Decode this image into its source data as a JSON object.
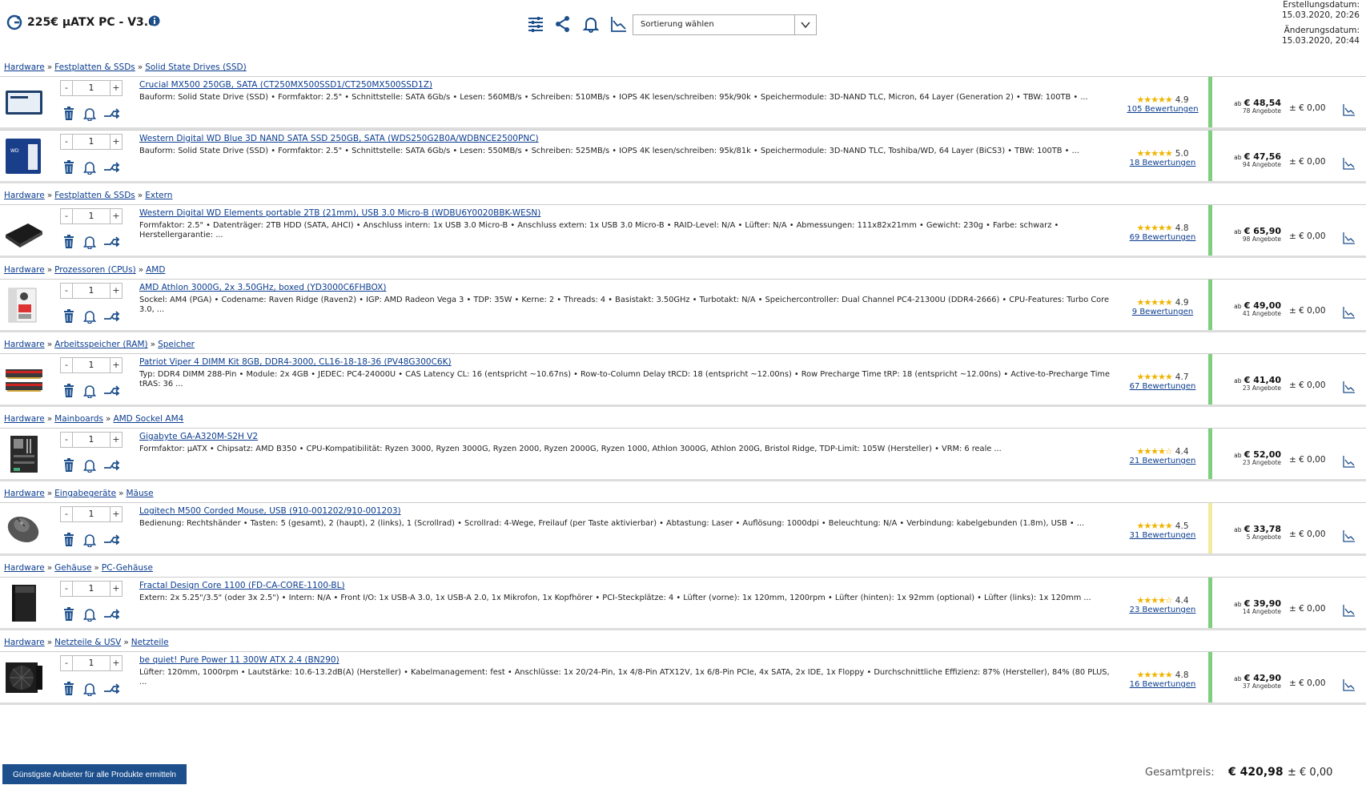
{
  "header": {
    "title": "225€ µATX PC - V3.0",
    "sort_placeholder": "Sortierung wählen",
    "created_label": "Erstellungsdatum:",
    "created_value": "15.03.2020, 20:26",
    "changed_label": "Änderungsdatum:",
    "changed_value": "15.03.2020, 20:44"
  },
  "groups": [
    {
      "crumbs": [
        "Hardware",
        "Festplatten & SSDs",
        "Solid State Drives (SSD)"
      ],
      "products": [
        {
          "name": "Crucial MX500 250GB, SATA (CT250MX500SSD1/CT250MX500SSD1Z)",
          "qty": "1",
          "desc": "Bauform: Solid State Drive (SSD) • Formfaktor: 2.5\" • Schnittstelle: SATA 6Gb/s • Lesen: 560MB/s • Schreiben: 510MB/s • IOPS 4K lesen/schreiben: 95k/90k • Speichermodule: 3D-NAND TLC, Micron, 64 Layer (Generation 2) • TBW: 100TB • ...",
          "rating": "4.9",
          "rating_fill": 0.98,
          "reviews": "105 Bewertungen",
          "price": "€ 48,54",
          "offers": "78 Angebote",
          "delta": "± € 0,00",
          "image": "ssd-crucial"
        },
        {
          "name": "Western Digital WD Blue 3D NAND SATA SSD 250GB, SATA (WDS250G2B0A/WDBNCE2500PNC)",
          "qty": "1",
          "desc": "Bauform: Solid State Drive (SSD) • Formfaktor: 2.5\" • Schnittstelle: SATA 6Gb/s • Lesen: 550MB/s • Schreiben: 525MB/s • IOPS 4K lesen/schreiben: 95k/81k • Speichermodule: 3D-NAND TLC, Toshiba/WD, 64 Layer (BiCS3) • TBW: 100TB • ...",
          "rating": "5.0",
          "rating_fill": 1.0,
          "reviews": "18 Bewertungen",
          "price": "€ 47,56",
          "offers": "94 Angebote",
          "delta": "± € 0,00",
          "image": "ssd-wd"
        }
      ]
    },
    {
      "crumbs": [
        "Hardware",
        "Festplatten & SSDs",
        "Extern"
      ],
      "products": [
        {
          "name": "Western Digital WD Elements portable 2TB (21mm), USB 3.0 Micro-B (WDBU6Y0020BBK-WESN)",
          "qty": "1",
          "desc": "Formfaktor: 2.5\" • Datenträger: 2TB HDD (SATA, AHCI) • Anschluss intern: 1x USB 3.0 Micro-B • Anschluss extern: 1x USB 3.0 Micro-B • RAID-Level: N/A • Lüfter: N/A • Abmessungen: 111x82x21mm • Gewicht: 230g • Farbe: schwarz • Herstellergarantie: ...",
          "rating": "4.8",
          "rating_fill": 0.96,
          "reviews": "69 Bewertungen",
          "price": "€ 65,90",
          "offers": "98 Angebote",
          "delta": "± € 0,00",
          "image": "hdd-external"
        }
      ]
    },
    {
      "crumbs": [
        "Hardware",
        "Prozessoren (CPUs)",
        "AMD"
      ],
      "products": [
        {
          "name": "AMD Athlon 3000G, 2x 3.50GHz, boxed (YD3000C6FHBOX)",
          "qty": "1",
          "desc": "Sockel: AM4 (PGA) • Codename: Raven Ridge (Raven2) • IGP: AMD Radeon Vega 3 • TDP: 35W • Kerne: 2 • Threads: 4 • Basistakt: 3.50GHz • Turbotakt: N/A • Speichercontroller: Dual Channel PC4-21300U (DDR4-2666) • CPU-Features: Turbo Core 3.0, ...",
          "rating": "4.9",
          "rating_fill": 0.98,
          "reviews": "9 Bewertungen",
          "price": "€ 49,00",
          "offers": "41 Angebote",
          "delta": "± € 0,00",
          "image": "cpu-box"
        }
      ]
    },
    {
      "crumbs": [
        "Hardware",
        "Arbeitsspeicher (RAM)",
        "Speicher"
      ],
      "products": [
        {
          "name": "Patriot Viper 4 DIMM Kit 8GB, DDR4-3000, CL16-18-18-36 (PV48G300C6K)",
          "qty": "1",
          "desc": "Typ: DDR4 DIMM 288-Pin • Module: 2x 4GB • JEDEC: PC4-24000U • CAS Latency CL: 16 (entspricht ~10.67ns) • Row-to-Column Delay tRCD: 18 (entspricht ~12.00ns) • Row Precharge Time tRP: 18 (entspricht ~12.00ns) • Active-to-Precharge Time tRAS: 36 ...",
          "rating": "4.7",
          "rating_fill": 0.94,
          "reviews": "67 Bewertungen",
          "price": "€ 41,40",
          "offers": "23 Angebote",
          "delta": "± € 0,00",
          "image": "ram-kit"
        }
      ]
    },
    {
      "crumbs": [
        "Hardware",
        "Mainboards",
        "AMD Sockel AM4"
      ],
      "products": [
        {
          "name": "Gigabyte GA-A320M-S2H V2",
          "qty": "1",
          "desc": "Formfaktor: µATX • Chipsatz: AMD B350 • CPU-Kompatibilität: Ryzen 3000, Ryzen 3000G, Ryzen 2000, Ryzen 2000G, Ryzen 1000, Athlon 3000G, Athlon 200G, Bristol Ridge, TDP-Limit: 105W (Hersteller) • VRM: 6 reale ...",
          "rating": "4.4",
          "rating_fill": 0.88,
          "reviews": "21 Bewertungen",
          "price": "€ 52,00",
          "offers": "23 Angebote",
          "delta": "± € 0,00",
          "image": "mainboard"
        }
      ]
    },
    {
      "crumbs": [
        "Hardware",
        "Eingabegeräte",
        "Mäuse"
      ],
      "products": [
        {
          "name": "Logitech M500 Corded Mouse, USB (910-001202/910-001203)",
          "qty": "1",
          "desc": "Bedienung: Rechtshänder • Tasten: 5 (gesamt), 2 (haupt), 2 (links), 1 (Scrollrad) • Scrollrad: 4-Wege, Freilauf (per Taste aktivierbar) • Abtastung: Laser • Auflösung: 1000dpi • Beleuchtung: N/A • Verbindung: kabelgebunden (1.8m), USB • ...",
          "rating": "4.5",
          "rating_fill": 0.9,
          "reviews": "31 Bewertungen",
          "price": "€ 33,78",
          "offers": "5 Angebote",
          "delta": "± € 0,00",
          "image": "mouse"
        }
      ]
    },
    {
      "crumbs": [
        "Hardware",
        "Gehäuse",
        "PC-Gehäuse"
      ],
      "products": [
        {
          "name": "Fractal Design Core 1100 (FD-CA-CORE-1100-BL)",
          "qty": "1",
          "desc": "Extern: 2x 5.25\"/3.5\" (oder 3x 2.5\") • Intern: N/A • Front I/O: 1x USB-A 3.0, 1x USB-A 2.0, 1x Mikrofon, 1x Kopfhörer • PCI-Steckplätze: 4 • Lüfter (vorne): 1x 120mm, 1200rpm • Lüfter (hinten): 1x 92mm (optional) • Lüfter (links): 1x 120mm ...",
          "rating": "4.4",
          "rating_fill": 0.88,
          "reviews": "23 Bewertungen",
          "price": "€ 39,90",
          "offers": "14 Angebote",
          "delta": "± € 0,00",
          "image": "case"
        }
      ]
    },
    {
      "crumbs": [
        "Hardware",
        "Netzteile & USV",
        "Netzteile"
      ],
      "products": [
        {
          "name": "be quiet! Pure Power 11 300W ATX 2.4 (BN290)",
          "qty": "1",
          "desc": "Lüfter: 120mm, 1000rpm • Lautstärke: 10.6-13.2dB(A) (Hersteller) • Kabelmanagement: fest • Anschlüsse: 1x 20/24-Pin, 1x 4/8-Pin ATX12V, 1x 6/8-Pin PCIe, 4x SATA, 2x IDE, 1x Floppy • Durchschnittliche Effizienz: 87% (Hersteller), 84% (80 PLUS, ...",
          "rating": "4.8",
          "rating_fill": 0.96,
          "reviews": "16 Bewertungen",
          "price": "€ 42,90",
          "offers": "37 Angebote",
          "delta": "± € 0,00",
          "image": "psu"
        }
      ]
    }
  ],
  "labels": {
    "ab": "ab",
    "minus": "-",
    "plus": "+",
    "crumb_sep": "»"
  },
  "footer": {
    "button": "Günstigste Anbieter für alle Produkte ermitteln",
    "total_label": "Gesamtpreis:",
    "total_value": "€ 420,98",
    "total_delta": "± € 0,00"
  },
  "colors": {
    "accent": "#1c4f8c",
    "link": "#0b3d8f",
    "availability_green": "#7ed07e",
    "availability_yellow": "#f3eaa0",
    "stars": "#f0b400"
  }
}
